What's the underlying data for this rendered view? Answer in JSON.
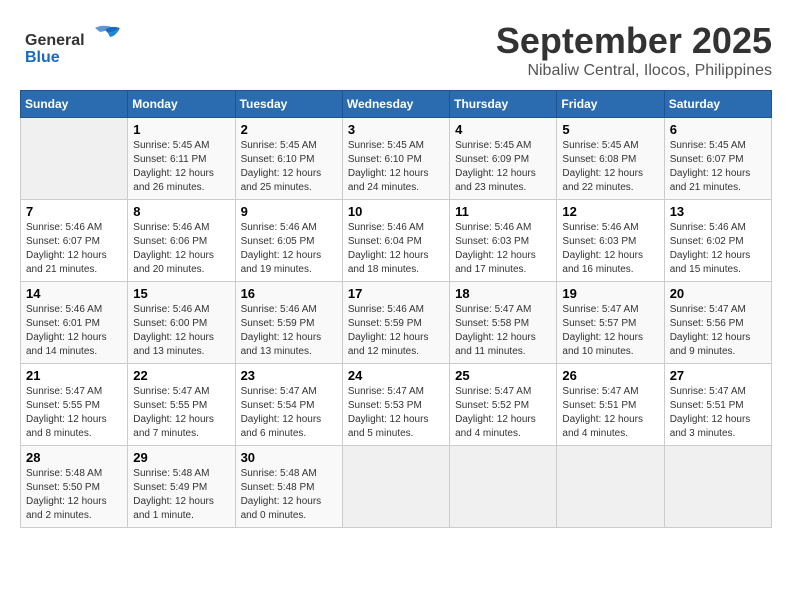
{
  "logo": {
    "general": "General",
    "blue": "Blue"
  },
  "header": {
    "month": "September 2025",
    "location": "Nibaliw Central, Ilocos, Philippines"
  },
  "days_of_week": [
    "Sunday",
    "Monday",
    "Tuesday",
    "Wednesday",
    "Thursday",
    "Friday",
    "Saturday"
  ],
  "weeks": [
    [
      {
        "day": null
      },
      {
        "day": "1",
        "sunrise": "Sunrise: 5:45 AM",
        "sunset": "Sunset: 6:11 PM",
        "daylight": "Daylight: 12 hours and 26 minutes."
      },
      {
        "day": "2",
        "sunrise": "Sunrise: 5:45 AM",
        "sunset": "Sunset: 6:10 PM",
        "daylight": "Daylight: 12 hours and 25 minutes."
      },
      {
        "day": "3",
        "sunrise": "Sunrise: 5:45 AM",
        "sunset": "Sunset: 6:10 PM",
        "daylight": "Daylight: 12 hours and 24 minutes."
      },
      {
        "day": "4",
        "sunrise": "Sunrise: 5:45 AM",
        "sunset": "Sunset: 6:09 PM",
        "daylight": "Daylight: 12 hours and 23 minutes."
      },
      {
        "day": "5",
        "sunrise": "Sunrise: 5:45 AM",
        "sunset": "Sunset: 6:08 PM",
        "daylight": "Daylight: 12 hours and 22 minutes."
      },
      {
        "day": "6",
        "sunrise": "Sunrise: 5:45 AM",
        "sunset": "Sunset: 6:07 PM",
        "daylight": "Daylight: 12 hours and 21 minutes."
      }
    ],
    [
      {
        "day": "7",
        "sunrise": "Sunrise: 5:46 AM",
        "sunset": "Sunset: 6:07 PM",
        "daylight": "Daylight: 12 hours and 21 minutes."
      },
      {
        "day": "8",
        "sunrise": "Sunrise: 5:46 AM",
        "sunset": "Sunset: 6:06 PM",
        "daylight": "Daylight: 12 hours and 20 minutes."
      },
      {
        "day": "9",
        "sunrise": "Sunrise: 5:46 AM",
        "sunset": "Sunset: 6:05 PM",
        "daylight": "Daylight: 12 hours and 19 minutes."
      },
      {
        "day": "10",
        "sunrise": "Sunrise: 5:46 AM",
        "sunset": "Sunset: 6:04 PM",
        "daylight": "Daylight: 12 hours and 18 minutes."
      },
      {
        "day": "11",
        "sunrise": "Sunrise: 5:46 AM",
        "sunset": "Sunset: 6:03 PM",
        "daylight": "Daylight: 12 hours and 17 minutes."
      },
      {
        "day": "12",
        "sunrise": "Sunrise: 5:46 AM",
        "sunset": "Sunset: 6:03 PM",
        "daylight": "Daylight: 12 hours and 16 minutes."
      },
      {
        "day": "13",
        "sunrise": "Sunrise: 5:46 AM",
        "sunset": "Sunset: 6:02 PM",
        "daylight": "Daylight: 12 hours and 15 minutes."
      }
    ],
    [
      {
        "day": "14",
        "sunrise": "Sunrise: 5:46 AM",
        "sunset": "Sunset: 6:01 PM",
        "daylight": "Daylight: 12 hours and 14 minutes."
      },
      {
        "day": "15",
        "sunrise": "Sunrise: 5:46 AM",
        "sunset": "Sunset: 6:00 PM",
        "daylight": "Daylight: 12 hours and 13 minutes."
      },
      {
        "day": "16",
        "sunrise": "Sunrise: 5:46 AM",
        "sunset": "Sunset: 5:59 PM",
        "daylight": "Daylight: 12 hours and 13 minutes."
      },
      {
        "day": "17",
        "sunrise": "Sunrise: 5:46 AM",
        "sunset": "Sunset: 5:59 PM",
        "daylight": "Daylight: 12 hours and 12 minutes."
      },
      {
        "day": "18",
        "sunrise": "Sunrise: 5:47 AM",
        "sunset": "Sunset: 5:58 PM",
        "daylight": "Daylight: 12 hours and 11 minutes."
      },
      {
        "day": "19",
        "sunrise": "Sunrise: 5:47 AM",
        "sunset": "Sunset: 5:57 PM",
        "daylight": "Daylight: 12 hours and 10 minutes."
      },
      {
        "day": "20",
        "sunrise": "Sunrise: 5:47 AM",
        "sunset": "Sunset: 5:56 PM",
        "daylight": "Daylight: 12 hours and 9 minutes."
      }
    ],
    [
      {
        "day": "21",
        "sunrise": "Sunrise: 5:47 AM",
        "sunset": "Sunset: 5:55 PM",
        "daylight": "Daylight: 12 hours and 8 minutes."
      },
      {
        "day": "22",
        "sunrise": "Sunrise: 5:47 AM",
        "sunset": "Sunset: 5:55 PM",
        "daylight": "Daylight: 12 hours and 7 minutes."
      },
      {
        "day": "23",
        "sunrise": "Sunrise: 5:47 AM",
        "sunset": "Sunset: 5:54 PM",
        "daylight": "Daylight: 12 hours and 6 minutes."
      },
      {
        "day": "24",
        "sunrise": "Sunrise: 5:47 AM",
        "sunset": "Sunset: 5:53 PM",
        "daylight": "Daylight: 12 hours and 5 minutes."
      },
      {
        "day": "25",
        "sunrise": "Sunrise: 5:47 AM",
        "sunset": "Sunset: 5:52 PM",
        "daylight": "Daylight: 12 hours and 4 minutes."
      },
      {
        "day": "26",
        "sunrise": "Sunrise: 5:47 AM",
        "sunset": "Sunset: 5:51 PM",
        "daylight": "Daylight: 12 hours and 4 minutes."
      },
      {
        "day": "27",
        "sunrise": "Sunrise: 5:47 AM",
        "sunset": "Sunset: 5:51 PM",
        "daylight": "Daylight: 12 hours and 3 minutes."
      }
    ],
    [
      {
        "day": "28",
        "sunrise": "Sunrise: 5:48 AM",
        "sunset": "Sunset: 5:50 PM",
        "daylight": "Daylight: 12 hours and 2 minutes."
      },
      {
        "day": "29",
        "sunrise": "Sunrise: 5:48 AM",
        "sunset": "Sunset: 5:49 PM",
        "daylight": "Daylight: 12 hours and 1 minute."
      },
      {
        "day": "30",
        "sunrise": "Sunrise: 5:48 AM",
        "sunset": "Sunset: 5:48 PM",
        "daylight": "Daylight: 12 hours and 0 minutes."
      },
      {
        "day": null
      },
      {
        "day": null
      },
      {
        "day": null
      },
      {
        "day": null
      }
    ]
  ]
}
